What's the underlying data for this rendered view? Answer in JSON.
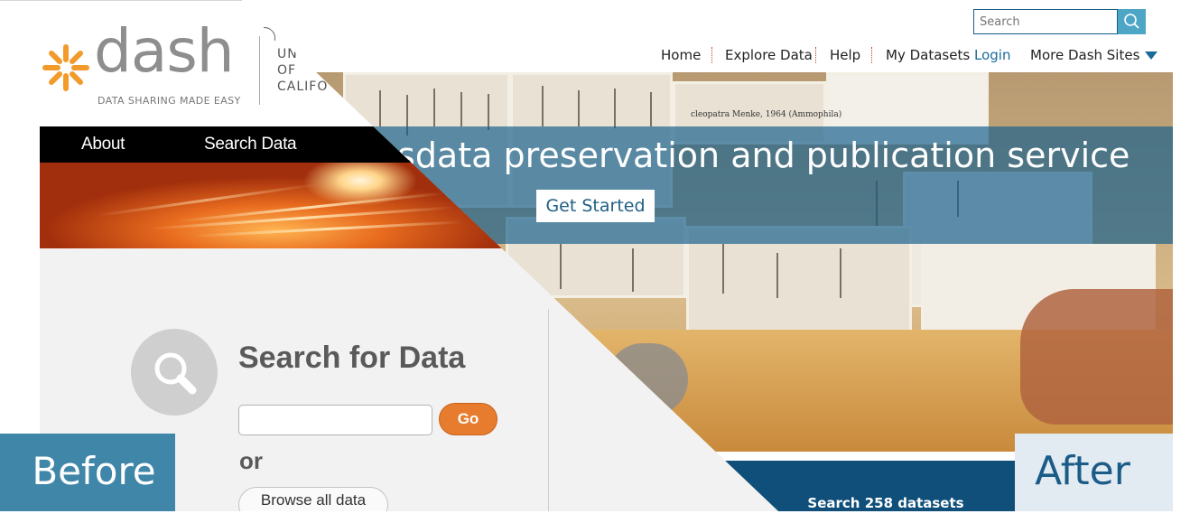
{
  "after": {
    "search": {
      "placeholder": "Search"
    },
    "nav": [
      "Home",
      "Explore Data",
      "Help",
      "My Datasets"
    ],
    "login_label": "Login",
    "more_sites_label": "More Dash Sites",
    "hero_title": "data preservation and publication service",
    "hero_title_leading_fragment": "s",
    "get_started_label": "Get Started",
    "search_datasets_label": "Search 258 datasets",
    "comparison_label": "After",
    "specimen_caption": "cleopatra Menke, 1964 (Ammophila)"
  },
  "before": {
    "logo_word": "dash",
    "logo_tagline": "DATA SHARING MADE EASY",
    "institution_lines": [
      "UN",
      "OF",
      "CALIFO"
    ],
    "nav": [
      "About",
      "Search Data"
    ],
    "search_title": "Search for Data",
    "go_label": "Go",
    "or_label": "or",
    "browse_label": "Browse all data",
    "comparison_label": "Before"
  },
  "colors": {
    "after_accent": "#1b5b87",
    "before_accent": "#e87c2e",
    "logo_orange": "#f29b2b",
    "before_label_bg": "#3f86a8",
    "after_label_bg": "#e2eaf2"
  }
}
